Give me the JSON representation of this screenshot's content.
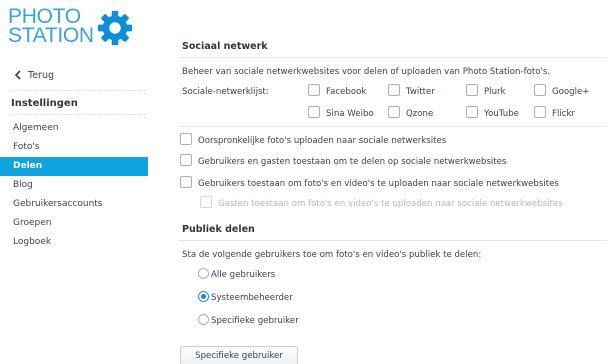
{
  "app": {
    "logo_text_line1": "PHOTO",
    "logo_text_line2": "STATION",
    "logo_icon": "gear-icon",
    "accent_color": "#0fa4df",
    "logo_color": "#3aa3d8"
  },
  "sidebar": {
    "back_label": "Terug",
    "back_icon": "chevron-left-icon",
    "title": "Instellingen",
    "items": [
      {
        "label": "Algemeen",
        "active": false
      },
      {
        "label": "Foto's",
        "active": false
      },
      {
        "label": "Delen",
        "active": true
      },
      {
        "label": "Blog",
        "active": false
      },
      {
        "label": "Gebruikersaccounts",
        "active": false
      },
      {
        "label": "Groepen",
        "active": false
      },
      {
        "label": "Logboek",
        "active": false
      }
    ]
  },
  "social": {
    "title": "Sociaal netwerk",
    "description": "Beheer van sociale netwerkwebsites voor delen of uploaden van Photo Station-foto's.",
    "list_label": "Sociale-netwerklijst:",
    "networks": [
      {
        "label": "Facebook",
        "checked": false
      },
      {
        "label": "Twitter",
        "checked": false
      },
      {
        "label": "Plurk",
        "checked": false
      },
      {
        "label": "Google+",
        "checked": false
      },
      {
        "label": "Sina Weibo",
        "checked": false
      },
      {
        "label": "Qzone",
        "checked": false
      },
      {
        "label": "YouTube",
        "checked": false
      },
      {
        "label": "Flickr",
        "checked": false
      }
    ],
    "options": [
      {
        "label": "Oorspronkelijke foto's uploaden naar sociale netwerksites",
        "checked": false,
        "disabled": false
      },
      {
        "label": "Gebruikers en gasten toestaan om te delen op sociale netwerkwebsites",
        "checked": false,
        "disabled": false
      },
      {
        "label": "Gebruikers toestaan om foto's en video's te uploaden naar sociale netwerkwebsites",
        "checked": false,
        "disabled": false
      },
      {
        "label": "Gasten toestaan om foto's en video's te uploaden naar sociale netwerkwebsites",
        "checked": false,
        "disabled": true
      }
    ]
  },
  "public": {
    "title": "Publiek delen",
    "description": "Sta de volgende gebruikers toe om foto's en video's publiek te delen:",
    "radios": [
      {
        "label": "Alle gebruikers",
        "checked": false
      },
      {
        "label": "Systeembeheerder",
        "checked": true
      },
      {
        "label": "Specifieke gebruiker",
        "checked": false
      }
    ],
    "button_label": "Specifieke gebruiker"
  }
}
